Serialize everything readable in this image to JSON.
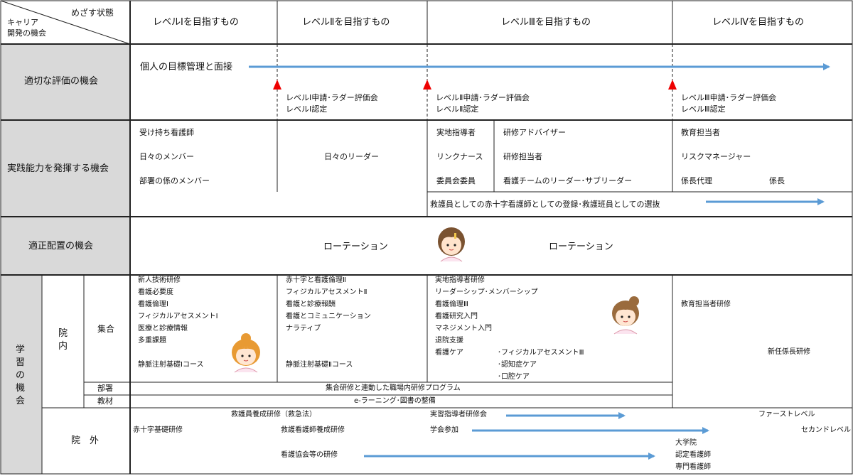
{
  "corner": {
    "goal": "めざす状態",
    "career_line1": "キャリア",
    "career_line2": "開発の機会"
  },
  "levels": [
    "レベルⅠを目指すもの",
    "レベルⅡを目指すもの",
    "レベルⅢを目指すもの",
    "レベルⅣを目指すもの"
  ],
  "rows": {
    "evaluation": "適切な評価の機会",
    "practice": "実践能力を発揮する機会",
    "placement": "適正配置の機会",
    "learning": [
      "学",
      "習",
      "の",
      "機",
      "会"
    ]
  },
  "evaluation": {
    "main": "個人の目標管理と面接",
    "lv1": [
      "レベルⅠ申請･ラダー評価会",
      "レベルⅠ認定"
    ],
    "lv2": [
      "レベルⅡ申請･ラダー評価会",
      "レベルⅡ認定"
    ],
    "lv3": [
      "レベルⅢ申請･ラダー評価会",
      "レベルⅢ認定"
    ]
  },
  "practice": {
    "col1": [
      "受け持ち看護師",
      "日々のメンバー",
      "部署の係のメンバー"
    ],
    "col2": "日々のリーダー",
    "col3a": [
      "実地指導者",
      "リンクナース",
      "委員会委員"
    ],
    "col3b": [
      "研修アドバイザー",
      "研修担当者",
      "看護チームのリーダー･サブリーダー"
    ],
    "col4": [
      "教育担当者",
      "リスクマネージャー",
      "係長代理",
      "係長"
    ],
    "rescue": "救護員としての赤十字看護師としての登録･救護班員としての選抜"
  },
  "placement": {
    "left": "ローテーション",
    "right": "ローテーション"
  },
  "learning": {
    "innai": [
      "院",
      "内"
    ],
    "shugo": "集合",
    "busho": "部署",
    "kyozai": "教材",
    "ingai": "院　外",
    "c1": [
      "新人技術研修",
      "看護必要度",
      "看護倫理Ⅰ",
      "フィジカルアセスメントⅠ",
      "医療と診療情報",
      "多重課題",
      "静脈注射基礎Ⅰコース"
    ],
    "c2": [
      "赤十字と看護倫理Ⅱ",
      "フィジカルアセスメントⅡ",
      "看護と診療報酬",
      "看護とコミュニケーション",
      "ナラティブ",
      "静脈注射基礎Ⅱコース"
    ],
    "c3": [
      "実地指導者研修",
      "リーダーシップ･メンバーシップ",
      "看護倫理Ⅲ",
      "看護研究入門",
      "マネジメント入門",
      "退院支援",
      "看護ケア"
    ],
    "c3care": [
      "･フィジカルアセスメントⅢ",
      "･認知症ケア",
      "･口腔ケア"
    ],
    "c4a": "教育担当者研修",
    "c4b": "新任係長研修",
    "busho_text": "集合研修と連動した職場内研修プログラム",
    "kyozai_text": "e-ラーニング･図書の整備",
    "out": {
      "a": "救護員養成研修（救急法）",
      "b": "赤十字基礎研修",
      "c": "救護看護師養成研修",
      "d": "看護協会等の研修",
      "e": "実習指導者研修会",
      "f": "学会参加",
      "g": "ファーストレベル",
      "h": "セカンドレベル",
      "i": [
        "大学院",
        "認定看護師",
        "専門看護師"
      ]
    }
  },
  "colors": {
    "arrow": "#5b9bd5",
    "gray": "#d9d9d9",
    "marker": "#ee0000"
  }
}
